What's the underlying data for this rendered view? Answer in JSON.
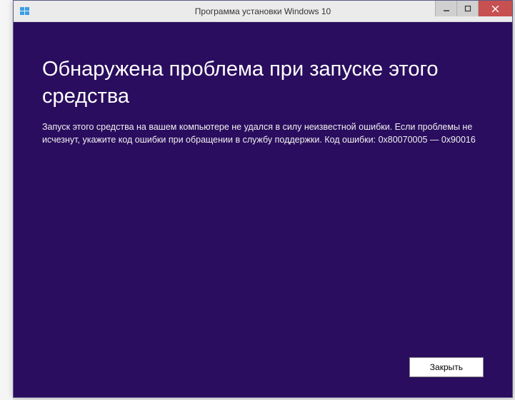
{
  "window": {
    "title": "Программа установки Windows 10"
  },
  "content": {
    "heading": "Обнаружена проблема при запуске этого средства",
    "description": "Запуск этого средства на вашем компьютере не удался в силу неизвестной ошибки. Если проблемы не исчезнут, укажите код ошибки при обращении в службу поддержки. Код ошибки: 0x80070005 — 0x90016"
  },
  "footer": {
    "close_label": "Закрыть"
  }
}
